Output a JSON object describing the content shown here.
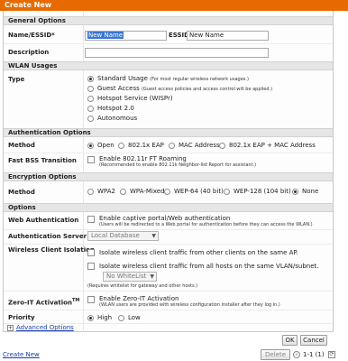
{
  "title": "Create New",
  "sections": {
    "general": "General Options",
    "wlan": "WLAN Usages",
    "auth": "Authentication Options",
    "enc": "Encryption Options",
    "options": "Options"
  },
  "general": {
    "name_label": "Name/ESSID*",
    "name_value": "New Name",
    "essid_label": "ESSID",
    "essid_value": "New Name",
    "desc_label": "Description",
    "desc_value": ""
  },
  "wlan": {
    "type_label": "Type",
    "types": [
      {
        "label": "Standard Usage",
        "note": "(For most regular wireless network usages.)",
        "selected": true
      },
      {
        "label": "Guest Access",
        "note": "(Guest access policies and access control will be applied.)",
        "selected": false
      },
      {
        "label": "Hotspot Service (WISPr)",
        "note": "",
        "selected": false
      },
      {
        "label": "Hotspot 2.0",
        "note": "",
        "selected": false
      },
      {
        "label": "Autonomous",
        "note": "",
        "selected": false
      }
    ]
  },
  "auth": {
    "method_label": "Method",
    "methods": [
      {
        "label": "Open",
        "selected": true
      },
      {
        "label": "802.1x EAP",
        "selected": false
      },
      {
        "label": "MAC Address",
        "selected": false
      },
      {
        "label": "802.1x EAP + MAC Address",
        "selected": false
      }
    ],
    "fbt_label": "Fast BSS Transition",
    "fbt_text": "Enable 802.11r FT Roaming",
    "fbt_note": "(Recommended to enable 802.11k Neighbor-list Report for assistant.)"
  },
  "enc": {
    "method_label": "Method",
    "methods": [
      {
        "label": "WPA2",
        "selected": false
      },
      {
        "label": "WPA-Mixed",
        "selected": false
      },
      {
        "label": "WEP-64 (40 bit)",
        "selected": false
      },
      {
        "label": "WEP-128 (104 bit)",
        "selected": false
      },
      {
        "label": "None",
        "selected": true
      }
    ]
  },
  "options": {
    "webauth_label": "Web Authentication",
    "webauth_text": "Enable captive portal/Web authentication",
    "webauth_note": "(Users will be redirected to a Web portal for authentication before they can access the WLAN.)",
    "authserver_label": "Authentication Server",
    "authserver_value": "Local Database",
    "isolation_label": "Wireless Client Isolation",
    "isolation_1": "Isolate wireless client traffic from other clients on the same AP.",
    "isolation_2": "Isolate wireless client traffic from all hosts on the same VLAN/subnet.",
    "whitelist_value": "No WhiteList",
    "whitelist_note": "(Requires whitelist for gateway and other hosts.)",
    "zeroit_label": "Zero-IT Activation",
    "zeroit_tm": "TM",
    "zeroit_text": "Enable Zero-IT Activation",
    "zeroit_note": "(WLAN users are provided with wireless configuration installer after they log in.)",
    "priority_label": "Priority",
    "priorities": [
      {
        "label": "High",
        "selected": true
      },
      {
        "label": "Low",
        "selected": false
      }
    ],
    "advanced": "Advanced Options",
    "advanced_toggle": "+"
  },
  "buttons": {
    "ok": "OK",
    "cancel": "Cancel",
    "delete": "Delete"
  },
  "footer": {
    "create_new": "Create New",
    "pager": "1-1 (1)"
  }
}
